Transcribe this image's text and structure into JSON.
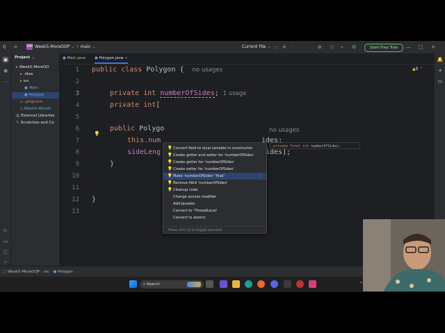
{
  "titlebar": {
    "project_initials": "WM",
    "project_name": "Week5-MoreOOP",
    "branch": "main",
    "run_config": "Current File",
    "free_trial": "Start Free Trial"
  },
  "project_panel": {
    "title": "Project",
    "tree": [
      {
        "label": "Week5-MoreOO",
        "depth": 0,
        "icon": "folder-icon"
      },
      {
        "label": ".idea",
        "depth": 1,
        "icon": "folder-icon"
      },
      {
        "label": "src",
        "depth": 1,
        "icon": "folder-icon"
      },
      {
        "label": "Main",
        "depth": 2,
        "icon": "class-icon"
      },
      {
        "label": "Polygon",
        "depth": 2,
        "icon": "class-icon",
        "selected": true
      },
      {
        "label": ".gitignore",
        "depth": 1,
        "icon": "file-icon"
      },
      {
        "label": "Week5-MoreO",
        "depth": 1,
        "icon": "file-icon"
      },
      {
        "label": "External Libraries",
        "depth": 0,
        "icon": "library-icon"
      },
      {
        "label": "Scratches and Co",
        "depth": 0,
        "icon": "scratch-icon"
      }
    ]
  },
  "tabs": [
    {
      "label": "Main.java",
      "active": false
    },
    {
      "label": "Polygon.java",
      "active": true,
      "close": "×"
    }
  ],
  "editor": {
    "warning_count": "8",
    "line_numbers": [
      "1",
      "2",
      "3",
      "4",
      "5",
      "6",
      "7",
      "8",
      "9",
      "10",
      "11",
      "12",
      "13"
    ],
    "current_line": "3",
    "line1": {
      "kw1": "public",
      "kw2": "class",
      "name": " Polygon {",
      "hint": "no usages"
    },
    "line3": {
      "kw1": "private",
      "kw2": "int",
      "field": "numberOfSides",
      "semi": ";",
      "hint": "1 usage"
    },
    "line4": {
      "kw1": "private",
      "kw2": "int",
      "rest": "["
    },
    "line6": {
      "kw1": "public",
      "rest": " Polygo",
      "hint": "no usages"
    },
    "line7": {
      "kw": "this",
      "rest": ".num",
      "tail": "ides;"
    },
    "line8": {
      "rest": "sideLeng",
      "tail": "Sides];"
    },
    "line9": {
      "text": "}"
    },
    "line12": {
      "text": "}"
    }
  },
  "intention_popup": {
    "actions": [
      {
        "label": "Convert field to local variable in constructor",
        "icon": "bulb"
      },
      {
        "label": "Create getter and setter for 'numberOfSides'",
        "icon": "bulb"
      },
      {
        "label": "Create getter for 'numberOfSides'",
        "icon": "bulb"
      },
      {
        "label": "Create setter for 'numberOfSides'",
        "icon": "bulb"
      },
      {
        "label": "Make 'numberOfSides' 'final'",
        "icon": "bulb",
        "selected": true
      },
      {
        "label": "Remove field 'numberOfSides'",
        "icon": "bulb"
      },
      {
        "label": "Cleanup code",
        "icon": "bulb"
      },
      {
        "label": "Change access modifier",
        "icon": "none"
      },
      {
        "label": "Add Javadoc",
        "icon": "none"
      },
      {
        "label": "Convert to 'ThreadLocal'",
        "icon": "none"
      },
      {
        "label": "Convert to atomic",
        "icon": "none"
      }
    ],
    "footer": "Press Ctrl+Q to toggle preview"
  },
  "preview": {
    "kw1": "private",
    "kw2": "final",
    "kw3": "int",
    "name": "numberOfSides;"
  },
  "statusbar": {
    "breadcrumb": [
      "Week5-MoreOOP",
      "src",
      "Polygon"
    ]
  },
  "taskbar": {
    "search_label": "Search"
  },
  "colors": {
    "accent": "#3574f0",
    "ide_bg": "#1e1f22",
    "panel_bg": "#2b2d30",
    "selection": "#2e436e",
    "keyword": "#cf8e6d",
    "field": "#c77dbb",
    "free_trial": "#5fb865"
  }
}
